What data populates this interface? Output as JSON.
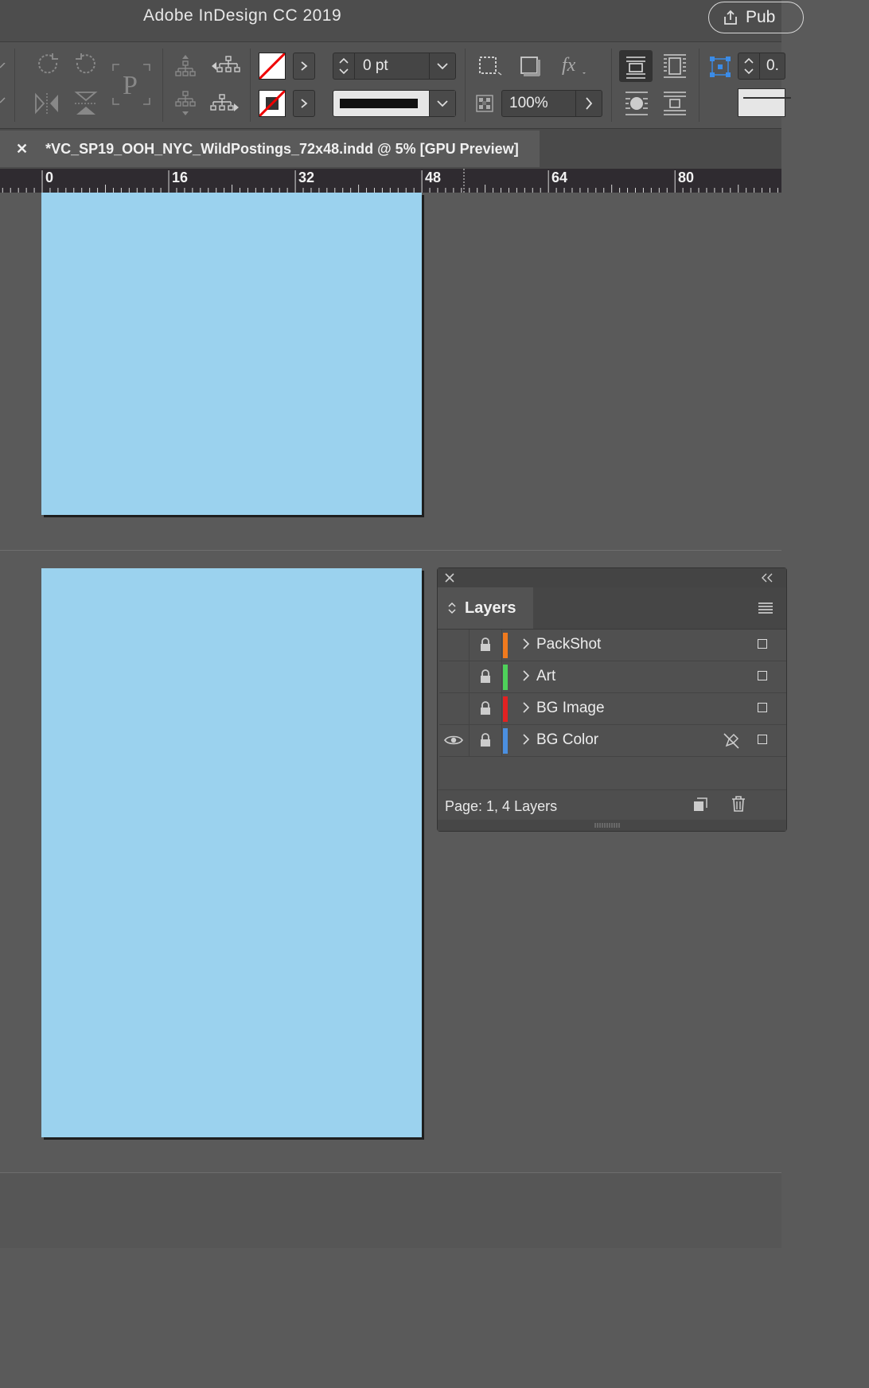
{
  "app": {
    "title": "Adobe InDesign CC 2019",
    "publish_label": "Pub"
  },
  "control_bar": {
    "stroke_weight": "0 pt",
    "opacity": "100%",
    "partial_field": "0.",
    "fill_swatch": "none",
    "stroke_swatch": "black-none",
    "icons": [
      "rotate-cw-icon",
      "rotate-ccw-icon",
      "flip-horizontal-icon",
      "flip-vertical-icon",
      "text-frame-icon",
      "select-container-icon",
      "select-previous-icon",
      "select-content-icon",
      "select-next-icon",
      "fill-swatch",
      "stroke-swatch",
      "stroke-type-dropdown",
      "frame-icon",
      "shadow-icon",
      "fx-icon",
      "opacity-icon",
      "text-wrap-none-icon",
      "text-wrap-bounding-icon",
      "text-wrap-object-icon",
      "text-wrap-jump-icon",
      "reference-point-icon"
    ]
  },
  "document_tab": {
    "title": "*VC_SP19_OOH_NYC_WildPostings_72x48.indd @ 5% [GPU Preview]"
  },
  "ruler": {
    "labels": [
      "0",
      "16",
      "32",
      "48",
      "64",
      "80"
    ]
  },
  "canvas": {
    "page_color": "#9bd2ee"
  },
  "layers_panel": {
    "tab_label": "Layers",
    "layers": [
      {
        "name": "PackShot",
        "color": "#f07a1e",
        "visible": false,
        "pen_icon": false
      },
      {
        "name": "Art",
        "color": "#4ed15a",
        "visible": false,
        "pen_icon": false
      },
      {
        "name": "BG Image",
        "color": "#e32222",
        "visible": false,
        "pen_icon": false
      },
      {
        "name": "BG Color",
        "color": "#4b8fe0",
        "visible": true,
        "pen_icon": true
      }
    ],
    "footer": "Page: 1, 4 Layers"
  }
}
